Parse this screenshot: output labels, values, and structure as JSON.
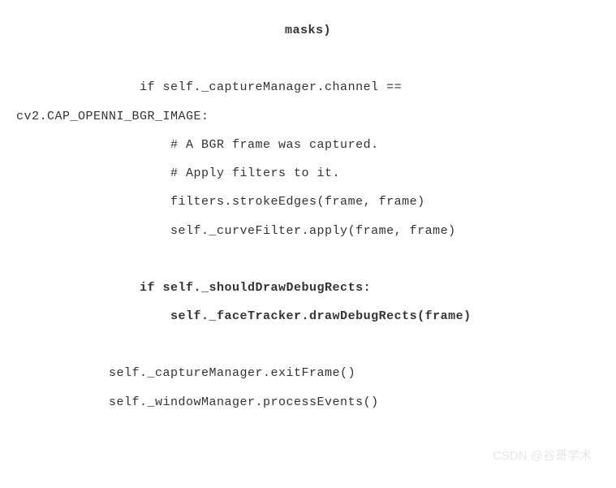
{
  "code": {
    "header": "masks)",
    "line1_indent": "                if self._captureManager.channel ==",
    "line2_unindent": "cv2.CAP_OPENNI_BGR_IMAGE:",
    "line3": "                    # A BGR frame was captured.",
    "line4": "                    # Apply filters to it.",
    "line5": "                    filters.strokeEdges(frame, frame)",
    "line6": "                    self._curveFilter.apply(frame, frame)",
    "line7_bold": "                if self._shouldDrawDebugRects:",
    "line8_bold": "                    self._faceTracker.drawDebugRects(frame)",
    "line9": "            self._captureManager.exitFrame()",
    "line10": "            self._windowManager.processEvents()"
  },
  "watermark": "CSDN @谷哥学术"
}
